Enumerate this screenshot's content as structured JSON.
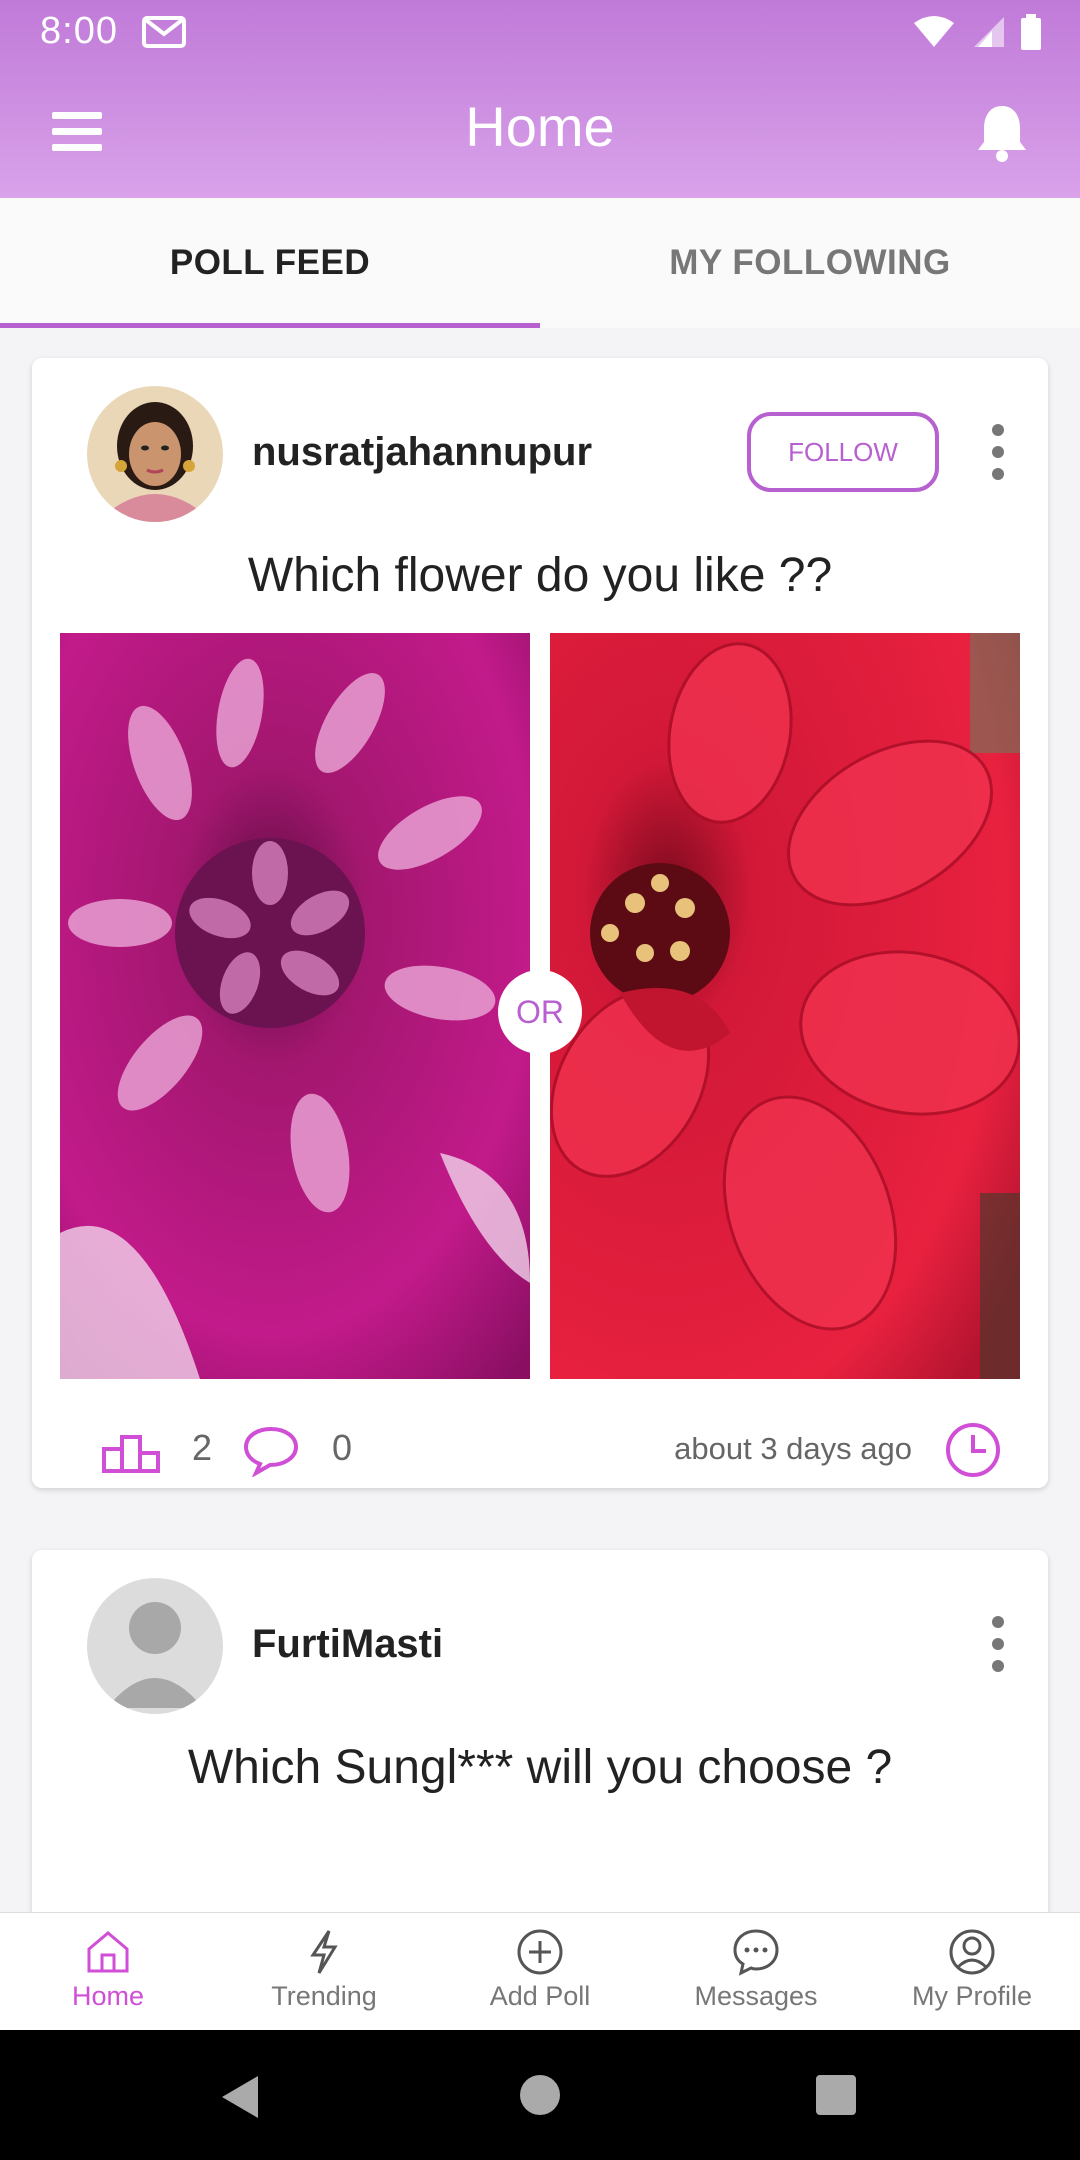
{
  "status": {
    "time": "8:00"
  },
  "header": {
    "title": "Home"
  },
  "tabs": [
    {
      "label": "POLL FEED",
      "active": true
    },
    {
      "label": "MY FOLLOWING",
      "active": false
    }
  ],
  "posts": [
    {
      "username": "nusratjahannupur",
      "follow_label": "FOLLOW",
      "question": "Which flower do you like ??",
      "or_label": "OR",
      "votes": "2",
      "comments": "0",
      "time_ago": "about 3 days ago",
      "option_colors": [
        "#b0167a",
        "#e01e3e"
      ]
    },
    {
      "username": "FurtiMasti",
      "question": "Which Sungl*** will you choose ?"
    }
  ],
  "bottom_nav": [
    {
      "label": "Home",
      "icon": "home-icon",
      "active": true
    },
    {
      "label": "Trending",
      "icon": "lightning-icon",
      "active": false
    },
    {
      "label": "Add Poll",
      "icon": "plus-circle-icon",
      "active": false
    },
    {
      "label": "Messages",
      "icon": "chat-bubble-icon",
      "active": false
    },
    {
      "label": "My Profile",
      "icon": "user-circle-icon",
      "active": false
    }
  ],
  "colors": {
    "accent": "#b760d0",
    "header_top": "#c07ad8",
    "header_bottom": "#d9a2ea",
    "nav_active": "#d04fd6"
  }
}
